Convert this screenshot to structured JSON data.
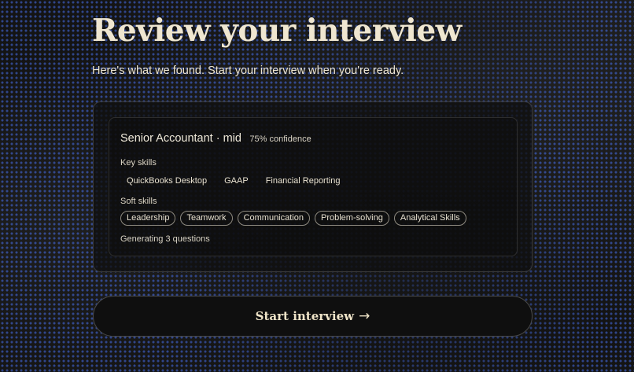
{
  "header": {
    "title": "Review your interview",
    "subtitle": "Here's what we found. Start your interview when you're ready."
  },
  "summary": {
    "role": "Senior Accountant · mid",
    "confidence": "75% confidence",
    "key_skills_label": "Key skills",
    "key_skills": [
      "QuickBooks Desktop",
      "GAAP",
      "Financial Reporting"
    ],
    "soft_skills_label": "Soft skills",
    "soft_skills": [
      "Leadership",
      "Teamwork",
      "Communication",
      "Problem-solving",
      "Analytical Skills"
    ],
    "status": "Generating 3 questions"
  },
  "actions": {
    "start_label": "Start interview",
    "start_arrow": "→"
  },
  "colors": {
    "background": "#141414",
    "dot_pattern": "#466eeb",
    "text_cream": "#efe6d0",
    "chip_border": "#8e8a80"
  }
}
